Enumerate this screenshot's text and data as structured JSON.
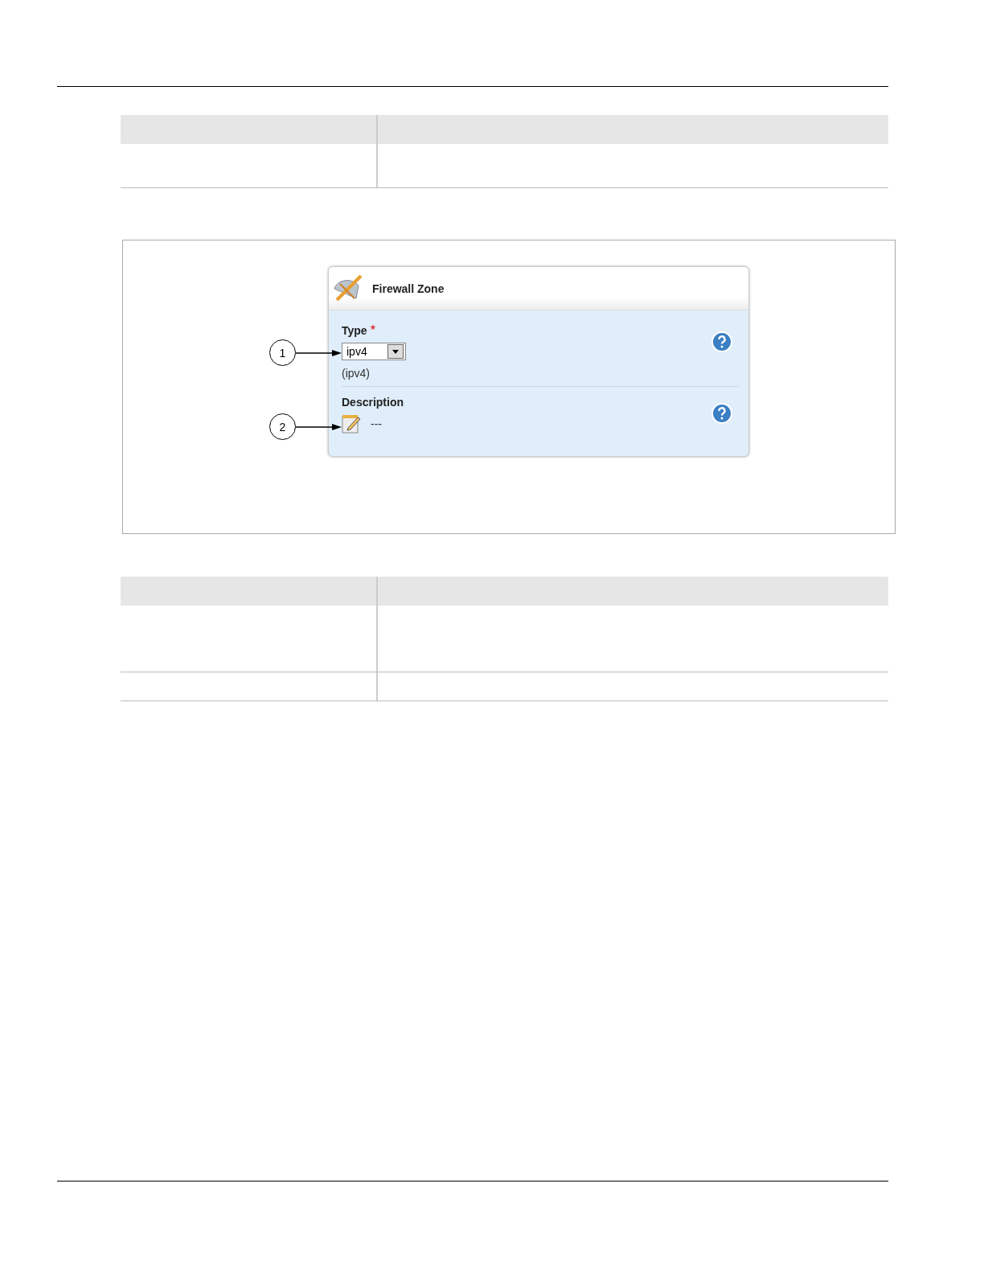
{
  "panel": {
    "title": "Firewall Zone"
  },
  "fields": [
    {
      "kind": "select",
      "label": "Type",
      "required_mark": "*",
      "value": "ipv4",
      "note": "(ipv4)"
    },
    {
      "kind": "text",
      "label": "Description",
      "value": "---"
    }
  ],
  "callouts": [
    "1",
    "2"
  ]
}
